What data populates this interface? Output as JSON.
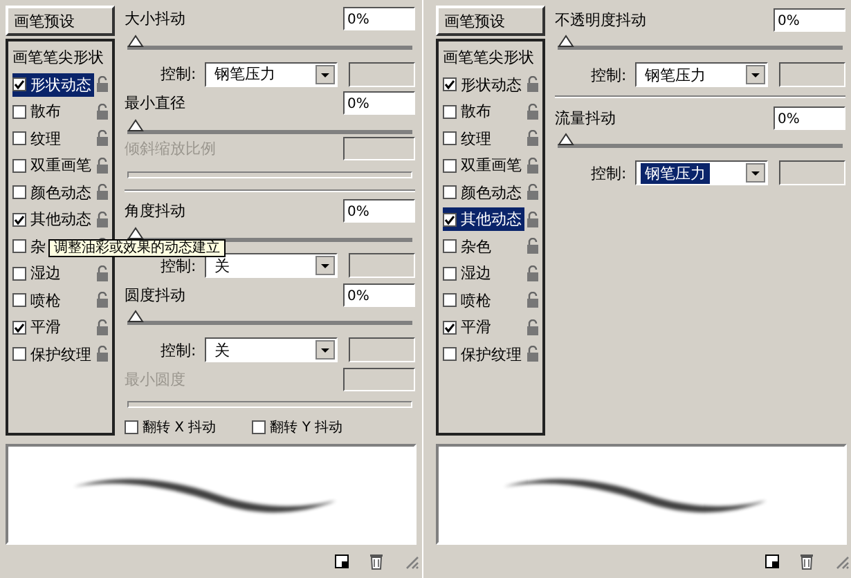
{
  "panels": [
    {
      "preset_button": "画笔预设",
      "sidebar": [
        {
          "kind": "plain",
          "label": "画笔笔尖形状",
          "selected": false
        },
        {
          "kind": "option",
          "label": "形状动态",
          "checked": true,
          "selected": true
        },
        {
          "kind": "option",
          "label": "散布",
          "checked": false,
          "selected": false
        },
        {
          "kind": "option",
          "label": "纹理",
          "checked": false,
          "selected": false
        },
        {
          "kind": "option",
          "label": "双重画笔",
          "checked": false,
          "selected": false
        },
        {
          "kind": "option",
          "label": "颜色动态",
          "checked": false,
          "selected": false
        },
        {
          "kind": "option",
          "label": "其他动态",
          "checked": true,
          "selected": false
        },
        {
          "kind": "option",
          "label": "杂",
          "checked": false,
          "selected": false
        },
        {
          "kind": "option",
          "label": "湿边",
          "checked": false,
          "selected": false
        },
        {
          "kind": "option",
          "label": "喷枪",
          "checked": false,
          "selected": false
        },
        {
          "kind": "option",
          "label": "平滑",
          "checked": true,
          "selected": false
        },
        {
          "kind": "option",
          "label": "保护纹理",
          "checked": false,
          "selected": false
        }
      ],
      "settings": [
        {
          "kind": "jitter",
          "label": "大小抖动",
          "value": "0%",
          "disabled": false
        },
        {
          "kind": "slider",
          "level": 0,
          "disabled": false
        },
        {
          "kind": "control",
          "label": "控制:",
          "value": "钢笔压力",
          "selected": false
        },
        {
          "kind": "jitter",
          "label": "最小直径",
          "value": "0%",
          "disabled": false
        },
        {
          "kind": "slider",
          "level": 0,
          "disabled": false
        },
        {
          "kind": "jitter",
          "label": "倾斜缩放比例",
          "disabled": true
        },
        {
          "kind": "slider",
          "disabled": true
        },
        {
          "kind": "divider"
        },
        {
          "kind": "jitter",
          "label": "角度抖动",
          "value": "0%",
          "disabled": false
        },
        {
          "kind": "slider",
          "level": 0,
          "disabled": false
        },
        {
          "kind": "control",
          "label": "控制:",
          "value": "关",
          "selected": false
        },
        {
          "kind": "jitter",
          "label": "圆度抖动",
          "value": "0%",
          "disabled": false
        },
        {
          "kind": "slider",
          "level": 0,
          "disabled": false
        },
        {
          "kind": "control",
          "label": "控制:",
          "value": "关",
          "selected": false
        },
        {
          "kind": "jitter",
          "label": "最小圆度",
          "disabled": true
        },
        {
          "kind": "slider",
          "disabled": true
        },
        {
          "kind": "flips",
          "items": [
            {
              "label": "翻转 X 抖动",
              "checked": false
            },
            {
              "label": "翻转 Y 抖动",
              "checked": false
            }
          ]
        }
      ],
      "tooltip": "调整油彩或效果的动态建立"
    },
    {
      "preset_button": "画笔预设",
      "sidebar": [
        {
          "kind": "plain",
          "label": "画笔笔尖形状",
          "selected": false
        },
        {
          "kind": "option",
          "label": "形状动态",
          "checked": true,
          "selected": false
        },
        {
          "kind": "option",
          "label": "散布",
          "checked": false,
          "selected": false
        },
        {
          "kind": "option",
          "label": "纹理",
          "checked": false,
          "selected": false
        },
        {
          "kind": "option",
          "label": "双重画笔",
          "checked": false,
          "selected": false
        },
        {
          "kind": "option",
          "label": "颜色动态",
          "checked": false,
          "selected": false
        },
        {
          "kind": "option",
          "label": "其他动态",
          "checked": true,
          "selected": true
        },
        {
          "kind": "option",
          "label": "杂色",
          "checked": false,
          "selected": false
        },
        {
          "kind": "option",
          "label": "湿边",
          "checked": false,
          "selected": false
        },
        {
          "kind": "option",
          "label": "喷枪",
          "checked": false,
          "selected": false
        },
        {
          "kind": "option",
          "label": "平滑",
          "checked": true,
          "selected": false
        },
        {
          "kind": "option",
          "label": "保护纹理",
          "checked": false,
          "selected": false
        }
      ],
      "settings": [
        {
          "kind": "jitter",
          "label": "不透明度抖动",
          "value": "0%",
          "disabled": false
        },
        {
          "kind": "slider",
          "level": 0,
          "disabled": false
        },
        {
          "kind": "control",
          "label": "控制:",
          "value": "钢笔压力",
          "selected": false
        },
        {
          "kind": "divider"
        },
        {
          "kind": "jitter",
          "label": "流量抖动",
          "value": "0%",
          "disabled": false
        },
        {
          "kind": "slider",
          "level": 0,
          "disabled": false
        },
        {
          "kind": "control",
          "label": "控制:",
          "value": "钢笔压力",
          "selected": true
        }
      ]
    }
  ]
}
